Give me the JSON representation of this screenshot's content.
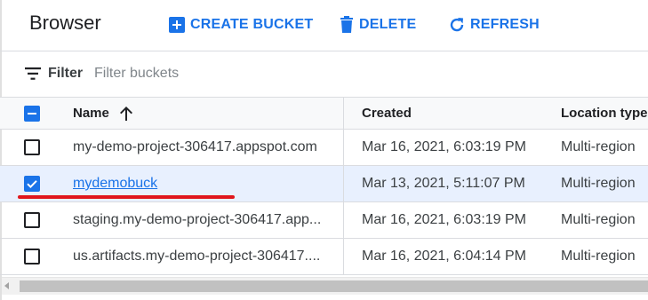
{
  "header": {
    "title": "Browser",
    "actions": [
      {
        "label": "CREATE BUCKET",
        "icon": "add-box-icon"
      },
      {
        "label": "DELETE",
        "icon": "trash-icon"
      },
      {
        "label": "REFRESH",
        "icon": "refresh-icon"
      }
    ]
  },
  "filter": {
    "label": "Filter",
    "placeholder": "Filter buckets",
    "value": ""
  },
  "table": {
    "columns": {
      "name": "Name",
      "created": "Created",
      "location": "Location type"
    },
    "sort": {
      "column": "name",
      "direction": "ascending"
    },
    "rows": [
      {
        "name": "my-demo-project-306417.appspot.com",
        "created": "Mar 16, 2021, 6:03:19 PM",
        "location": "Multi-region",
        "checked": false,
        "link": false
      },
      {
        "name": "mydemobuck",
        "created": "Mar 13, 2021, 5:11:07 PM",
        "location": "Multi-region",
        "checked": true,
        "link": true
      },
      {
        "name": "staging.my-demo-project-306417.app...",
        "created": "Mar 16, 2021, 6:03:19 PM",
        "location": "Multi-region",
        "checked": false,
        "link": false
      },
      {
        "name": "us.artifacts.my-demo-project-306417....",
        "created": "Mar 16, 2021, 6:04:14 PM",
        "location": "Multi-region",
        "checked": false,
        "link": false
      }
    ]
  },
  "colors": {
    "accent": "#1a73e8",
    "selected_row": "#e8f0fe",
    "annotation": "#e0161c"
  }
}
